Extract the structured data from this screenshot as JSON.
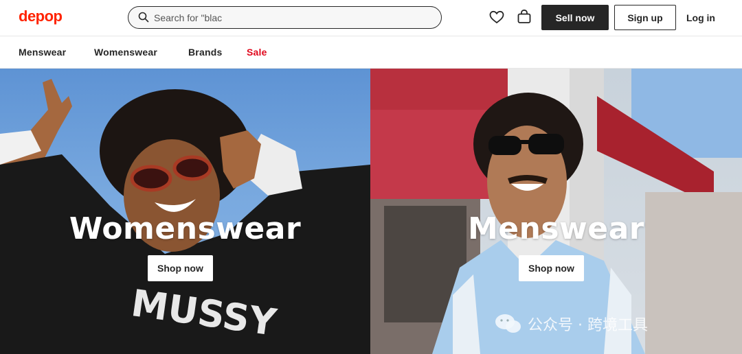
{
  "header": {
    "logo": "depop",
    "search_placeholder": "Search for \"blac",
    "sell_label": "Sell now",
    "signup_label": "Sign up",
    "login_label": "Log in"
  },
  "nav": {
    "items": [
      {
        "label": "Menswear"
      },
      {
        "label": "Womenswear"
      },
      {
        "label": "Brands"
      },
      {
        "label": "Sale"
      }
    ]
  },
  "hero": {
    "left": {
      "title": "Womenswear",
      "button": "Shop now",
      "shirt_text": "MUSSY"
    },
    "right": {
      "title": "Menswear",
      "button": "Shop now"
    }
  },
  "watermark": {
    "text": "公众号 · 跨境工具"
  },
  "colors": {
    "brand": "#ff2300",
    "sale": "#e0081d",
    "dark": "#262626"
  }
}
